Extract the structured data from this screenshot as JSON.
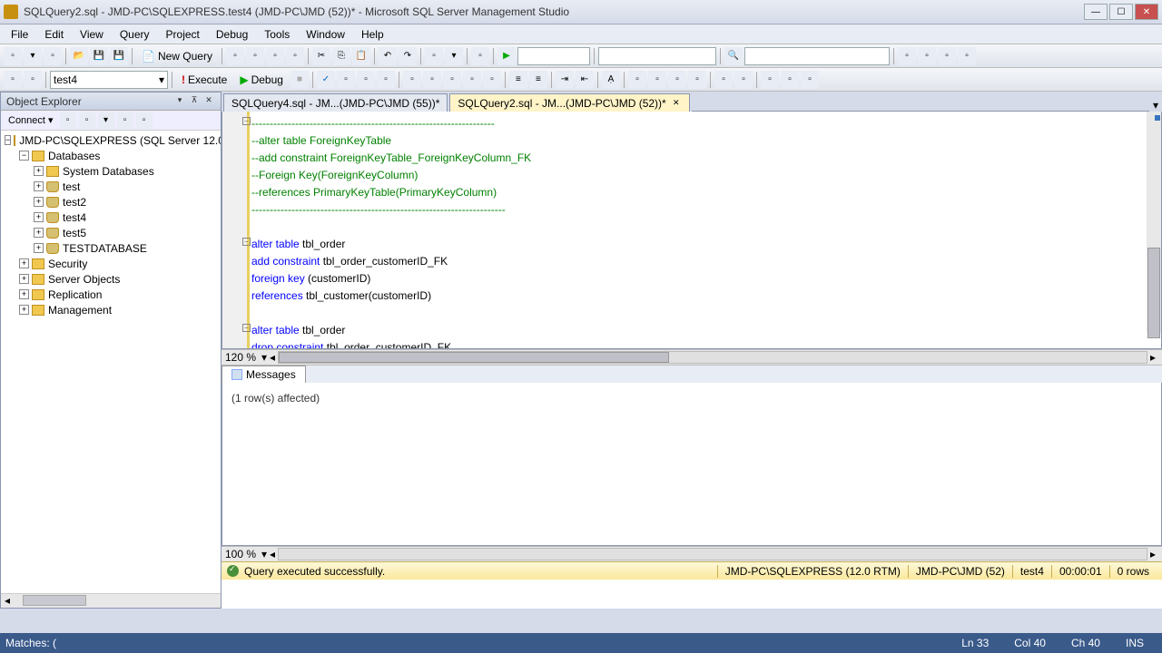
{
  "titlebar": {
    "text": "SQLQuery2.sql - JMD-PC\\SQLEXPRESS.test4 (JMD-PC\\JMD (52))* - Microsoft SQL Server Management Studio"
  },
  "menu": {
    "items": [
      "File",
      "Edit",
      "View",
      "Query",
      "Project",
      "Debug",
      "Tools",
      "Window",
      "Help"
    ]
  },
  "toolbar": {
    "new_query": "New Query",
    "db_selected": "test4",
    "execute": "Execute",
    "debug": "Debug"
  },
  "object_explorer": {
    "title": "Object Explorer",
    "connect": "Connect ▾",
    "server": "JMD-PC\\SQLEXPRESS (SQL Server 12.0...",
    "nodes": {
      "databases": "Databases",
      "system_db": "System Databases",
      "db_list": [
        "test",
        "test2",
        "test4",
        "test5",
        "TESTDATABASE"
      ],
      "security": "Security",
      "server_objects": "Server Objects",
      "replication": "Replication",
      "management": "Management"
    }
  },
  "tabs": {
    "inactive": "SQLQuery4.sql - JM...(JMD-PC\\JMD (55))*",
    "active": "SQLQuery2.sql - JM...(JMD-PC\\JMD (52))*"
  },
  "editor": {
    "zoom": "120 %",
    "lines": [
      {
        "type": "comment",
        "text": "-------------------------------------------------------------------"
      },
      {
        "type": "comment",
        "text": "--alter table ForeignKeyTable"
      },
      {
        "type": "comment",
        "text": "--add constraint ForeignKeyTable_ForeignKeyColumn_FK"
      },
      {
        "type": "comment",
        "text": "--Foreign Key(ForeignKeyColumn)"
      },
      {
        "type": "comment",
        "text": "--references PrimaryKeyTable(PrimaryKeyColumn)"
      },
      {
        "type": "comment",
        "text": "----------------------------------------------------------------------"
      },
      {
        "type": "blank",
        "text": ""
      },
      {
        "type": "sql",
        "tokens": [
          {
            "c": "kw",
            "t": "alter table"
          },
          {
            "c": "tx",
            "t": " tbl_order"
          }
        ]
      },
      {
        "type": "sql",
        "tokens": [
          {
            "c": "kw",
            "t": "add constraint"
          },
          {
            "c": "tx",
            "t": " tbl_order_customerID_FK"
          }
        ]
      },
      {
        "type": "sql",
        "tokens": [
          {
            "c": "kw",
            "t": "foreign key "
          },
          {
            "c": "tx",
            "t": "(customerID)"
          }
        ]
      },
      {
        "type": "sql",
        "tokens": [
          {
            "c": "kw",
            "t": "references"
          },
          {
            "c": "tx",
            "t": " tbl_customer(customerID)"
          }
        ]
      },
      {
        "type": "blank",
        "text": ""
      },
      {
        "type": "sql",
        "tokens": [
          {
            "c": "kw",
            "t": "alter table"
          },
          {
            "c": "tx",
            "t": " tbl_order"
          }
        ]
      },
      {
        "type": "sql",
        "tokens": [
          {
            "c": "kw",
            "t": "drop constraint"
          },
          {
            "c": "tx",
            "t": " tbl_order_customerID_FK"
          }
        ]
      }
    ]
  },
  "results": {
    "tab": "Messages",
    "zoom": "100 %",
    "message": "(1 row(s) affected)"
  },
  "status": {
    "text": "Query executed successfully.",
    "server": "JMD-PC\\SQLEXPRESS (12.0 RTM)",
    "user": "JMD-PC\\JMD (52)",
    "db": "test4",
    "time": "00:00:01",
    "rows": "0 rows"
  },
  "footer": {
    "matches": "Matches: (",
    "ln": "Ln 33",
    "col": "Col 40",
    "ch": "Ch 40",
    "ins": "INS"
  }
}
